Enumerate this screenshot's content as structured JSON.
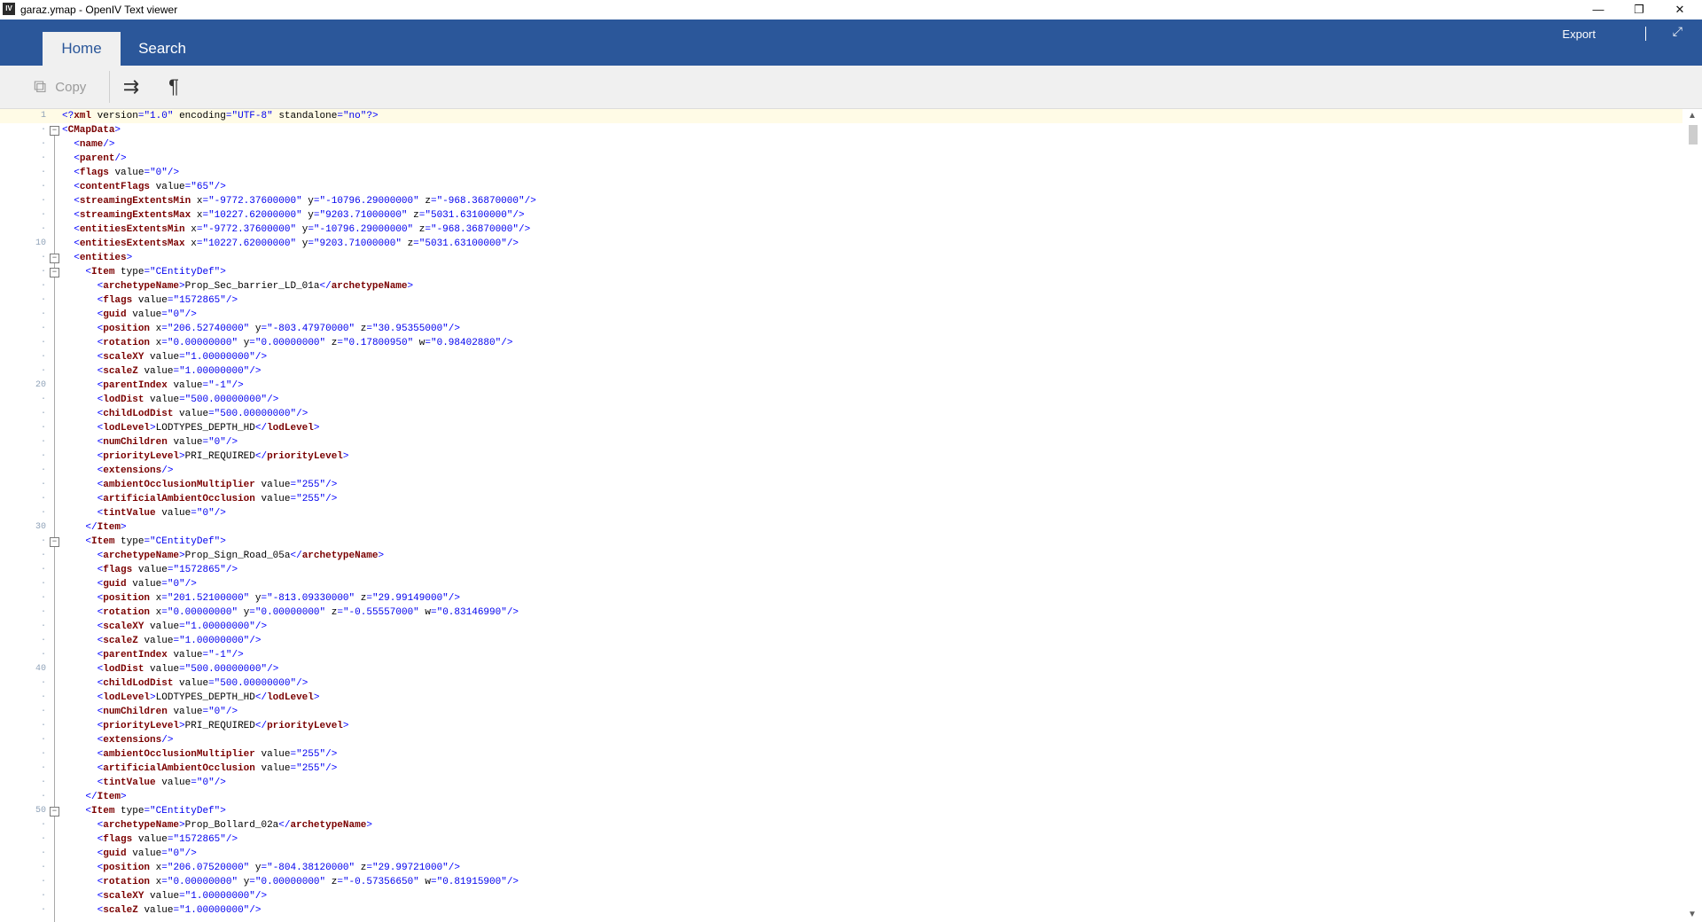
{
  "window": {
    "icon_text": "IV",
    "title": "garaz.ymap - OpenIV Text viewer",
    "minimize": "—",
    "restore": "❐",
    "close": "✕"
  },
  "ribbon": {
    "tabs": [
      {
        "label": "Home"
      },
      {
        "label": "Search"
      }
    ],
    "export_label": "Export",
    "expand_icon": "⤢"
  },
  "toolbar": {
    "copy_label": "Copy",
    "copy_icon": "⧉",
    "wrap_icon": "⇉",
    "pilcrow_icon": "¶"
  },
  "editor": {
    "line_numbers": [
      {
        "n": "1",
        "l": 0
      },
      {
        "n": "10",
        "l": 9
      },
      {
        "n": "20",
        "l": 19
      },
      {
        "n": "30",
        "l": 29
      },
      {
        "n": "40",
        "l": 39
      },
      {
        "n": "50",
        "l": 49
      }
    ],
    "folds": [
      1,
      10,
      11,
      30,
      49
    ],
    "lines": [
      "<?xml version=\"1.0\" encoding=\"UTF-8\" standalone=\"no\"?>",
      "<CMapData>",
      "  <name/>",
      "  <parent/>",
      "  <flags value=\"0\"/>",
      "  <contentFlags value=\"65\"/>",
      "  <streamingExtentsMin x=\"-9772.37600000\" y=\"-10796.29000000\" z=\"-968.36870000\"/>",
      "  <streamingExtentsMax x=\"10227.62000000\" y=\"9203.71000000\" z=\"5031.63100000\"/>",
      "  <entitiesExtentsMin x=\"-9772.37600000\" y=\"-10796.29000000\" z=\"-968.36870000\"/>",
      "  <entitiesExtentsMax x=\"10227.62000000\" y=\"9203.71000000\" z=\"5031.63100000\"/>",
      "  <entities>",
      "    <Item type=\"CEntityDef\">",
      "      <archetypeName>Prop_Sec_barrier_LD_01a</archetypeName>",
      "      <flags value=\"1572865\"/>",
      "      <guid value=\"0\"/>",
      "      <position x=\"206.52740000\" y=\"-803.47970000\" z=\"30.95355000\"/>",
      "      <rotation x=\"0.00000000\" y=\"0.00000000\" z=\"0.17800950\" w=\"0.98402880\"/>",
      "      <scaleXY value=\"1.00000000\"/>",
      "      <scaleZ value=\"1.00000000\"/>",
      "      <parentIndex value=\"-1\"/>",
      "      <lodDist value=\"500.00000000\"/>",
      "      <childLodDist value=\"500.00000000\"/>",
      "      <lodLevel>LODTYPES_DEPTH_HD</lodLevel>",
      "      <numChildren value=\"0\"/>",
      "      <priorityLevel>PRI_REQUIRED</priorityLevel>",
      "      <extensions/>",
      "      <ambientOcclusionMultiplier value=\"255\"/>",
      "      <artificialAmbientOcclusion value=\"255\"/>",
      "      <tintValue value=\"0\"/>",
      "    </Item>",
      "    <Item type=\"CEntityDef\">",
      "      <archetypeName>Prop_Sign_Road_05a</archetypeName>",
      "      <flags value=\"1572865\"/>",
      "      <guid value=\"0\"/>",
      "      <position x=\"201.52100000\" y=\"-813.09330000\" z=\"29.99149000\"/>",
      "      <rotation x=\"0.00000000\" y=\"0.00000000\" z=\"-0.55557000\" w=\"0.83146990\"/>",
      "      <scaleXY value=\"1.00000000\"/>",
      "      <scaleZ value=\"1.00000000\"/>",
      "      <parentIndex value=\"-1\"/>",
      "      <lodDist value=\"500.00000000\"/>",
      "      <childLodDist value=\"500.00000000\"/>",
      "      <lodLevel>LODTYPES_DEPTH_HD</lodLevel>",
      "      <numChildren value=\"0\"/>",
      "      <priorityLevel>PRI_REQUIRED</priorityLevel>",
      "      <extensions/>",
      "      <ambientOcclusionMultiplier value=\"255\"/>",
      "      <artificialAmbientOcclusion value=\"255\"/>",
      "      <tintValue value=\"0\"/>",
      "    </Item>",
      "    <Item type=\"CEntityDef\">",
      "      <archetypeName>Prop_Bollard_02a</archetypeName>",
      "      <flags value=\"1572865\"/>",
      "      <guid value=\"0\"/>",
      "      <position x=\"206.07520000\" y=\"-804.38120000\" z=\"29.99721000\"/>",
      "      <rotation x=\"0.00000000\" y=\"0.00000000\" z=\"-0.57356650\" w=\"0.81915900\"/>",
      "      <scaleXY value=\"1.00000000\"/>",
      "      <scaleZ value=\"1.00000000\"/>"
    ]
  },
  "scrollbar": {
    "up_icon": "▲",
    "down_icon": "▼"
  }
}
